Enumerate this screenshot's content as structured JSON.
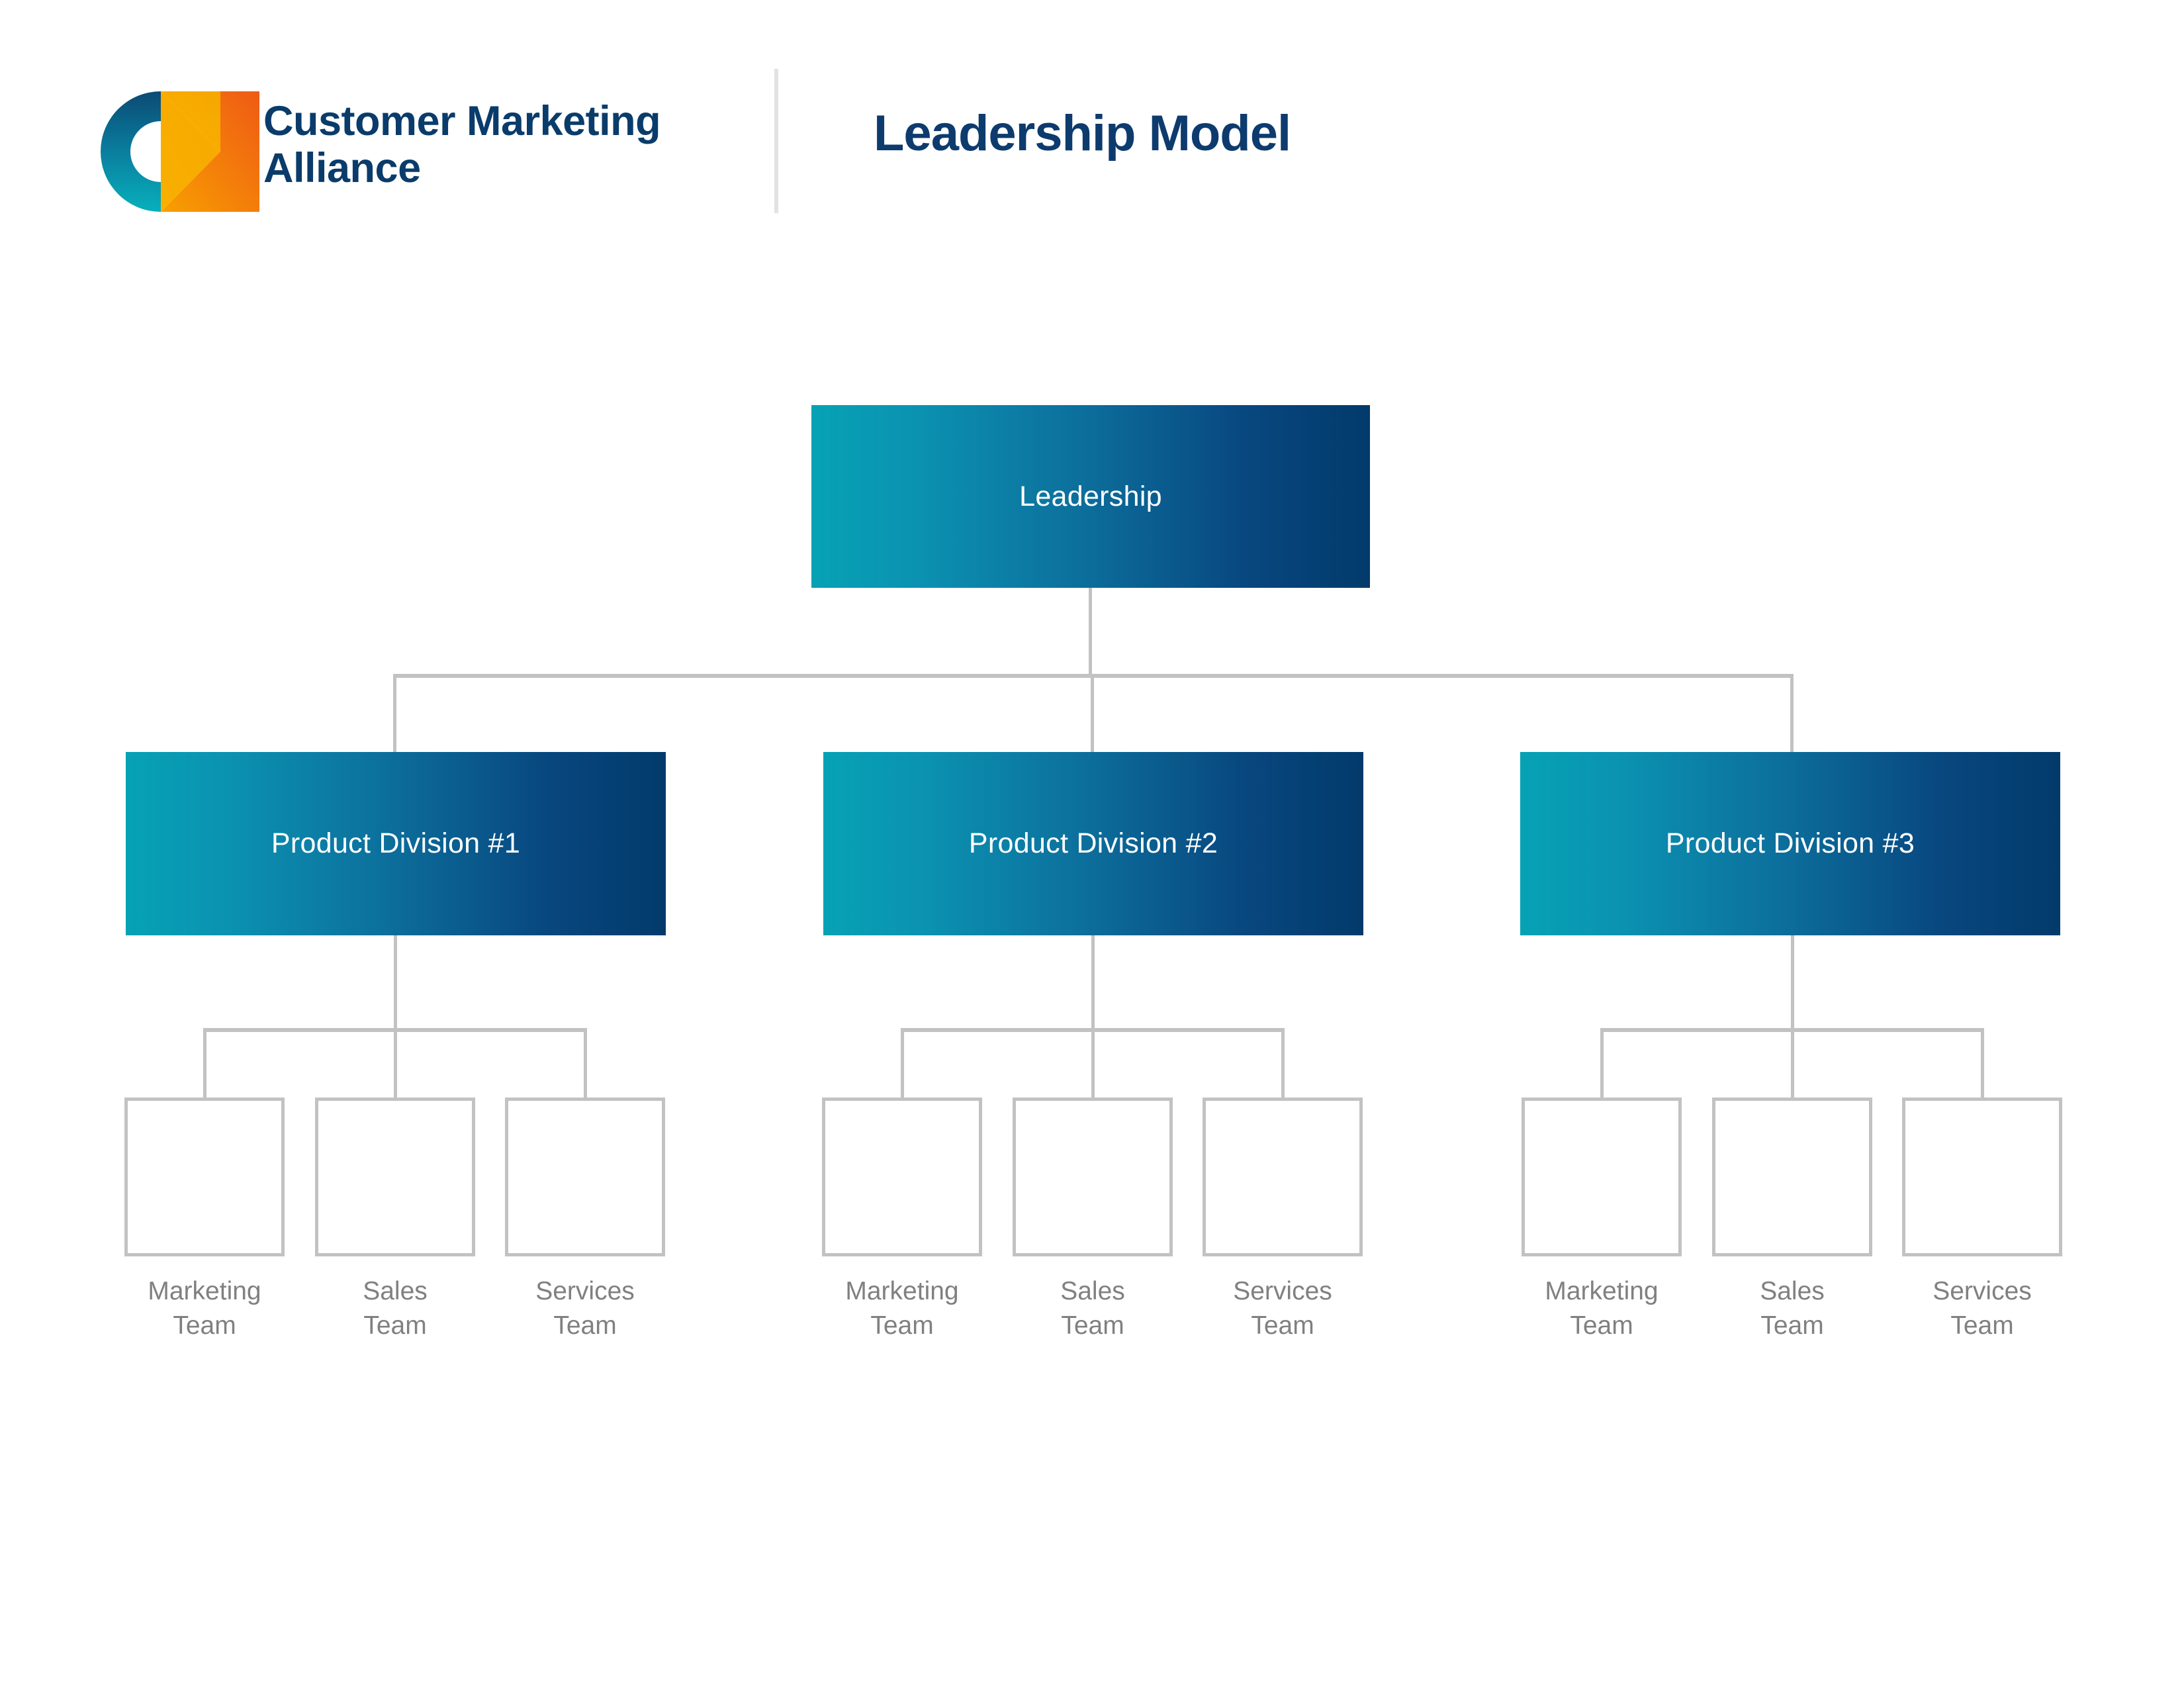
{
  "header": {
    "brand_line_1": "Customer Marketing",
    "brand_line_2": "Alliance",
    "title": "Leadership Model",
    "logo_icon": "cma-monogram-logo",
    "divider_icon": "vertical-divider"
  },
  "colors": {
    "brand_navy": "#0a3c6b",
    "title_navy": "#0d3b6e",
    "node_gradient_start": "#06a2b4",
    "node_gradient_end": "#023a6b",
    "connector_gray": "#c2c2c2",
    "label_gray": "#808080",
    "logo_blue_dark": "#0b4a74",
    "logo_teal": "#07a7b8",
    "logo_orange": "#ef5a15",
    "logo_yellow": "#f9b000"
  },
  "chart_data": {
    "type": "org-chart",
    "title": "Leadership Model",
    "root": {
      "label": "Leadership",
      "level": 0
    },
    "divisions": [
      {
        "label": "Product Division #1",
        "level": 1,
        "teams": [
          {
            "line1": "Marketing",
            "line2": "Team"
          },
          {
            "line1": "Sales",
            "line2": "Team"
          },
          {
            "line1": "Services",
            "line2": "Team"
          }
        ]
      },
      {
        "label": "Product Division #2",
        "level": 1,
        "teams": [
          {
            "line1": "Marketing",
            "line2": "Team"
          },
          {
            "line1": "Sales",
            "line2": "Team"
          },
          {
            "line1": "Services",
            "line2": "Team"
          }
        ]
      },
      {
        "label": "Product Division #3",
        "level": 1,
        "teams": [
          {
            "line1": "Marketing",
            "line2": "Team"
          },
          {
            "line1": "Sales",
            "line2": "Team"
          },
          {
            "line1": "Services",
            "line2": "Team"
          }
        ]
      }
    ],
    "levels": 3,
    "branching": [
      3,
      3
    ]
  }
}
